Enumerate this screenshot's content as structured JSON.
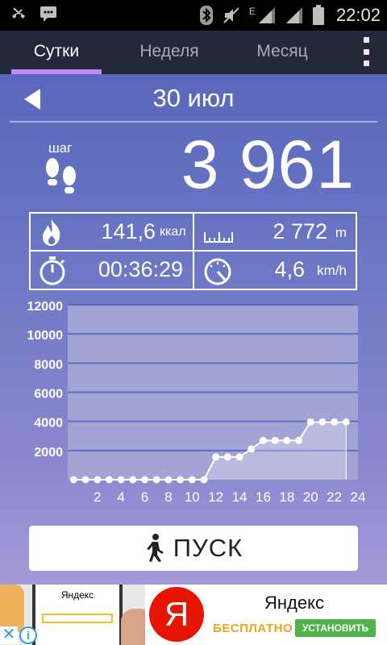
{
  "status_bar": {
    "time": "22:02",
    "network_label": "E",
    "icons": [
      "missed-call-icon",
      "message-icon",
      "bluetooth-icon",
      "mute-icon",
      "signal-icon",
      "signal-icon",
      "battery-icon"
    ]
  },
  "tabs": [
    {
      "label": "Сутки",
      "active": true
    },
    {
      "label": "Неделя",
      "active": false
    },
    {
      "label": "Месяц",
      "active": false
    }
  ],
  "date": "30 июл",
  "steps": {
    "label": "шаг",
    "value": "3 961"
  },
  "stats": {
    "calories": {
      "value": "141,6",
      "unit": "ккал"
    },
    "distance": {
      "value": "2 772",
      "unit": "m"
    },
    "duration": {
      "value": "00:36:29"
    },
    "speed": {
      "value": "4,6",
      "unit": "km/h"
    }
  },
  "chart_data": {
    "type": "area",
    "x": [
      0,
      1,
      2,
      3,
      4,
      5,
      6,
      7,
      8,
      9,
      10,
      11,
      12,
      13,
      14,
      15,
      16,
      17,
      18,
      19,
      20,
      21,
      22,
      23
    ],
    "y": [
      0,
      0,
      0,
      0,
      0,
      0,
      0,
      0,
      0,
      0,
      0,
      0,
      1560,
      1560,
      1560,
      2110,
      2690,
      2690,
      2690,
      2690,
      3961,
      3961,
      3961,
      3961
    ],
    "xlim": [
      -0.5,
      24
    ],
    "ylim": [
      0,
      12000
    ],
    "yticks": [
      2000,
      4000,
      6000,
      8000,
      10000,
      12000
    ],
    "xticks": [
      2,
      4,
      6,
      8,
      10,
      12,
      14,
      16,
      18,
      20,
      22,
      24
    ],
    "grid": true,
    "title": "",
    "xlabel": "",
    "ylabel": "",
    "colors": {
      "fill": "#e6e6f3",
      "line": "#ffffff",
      "grid": "#5f6cc4",
      "plot_bg": "#a1a4d4"
    }
  },
  "start_button": {
    "label": "ПУСК"
  },
  "ad": {
    "screenshot_text": "Яндекс",
    "logo_letter": "Я",
    "title": "Яндекс",
    "free_label": "БЕСПЛАТНО",
    "install_label": "УСТАНОВИТЬ",
    "close_label": "✕",
    "info_label": "i"
  }
}
